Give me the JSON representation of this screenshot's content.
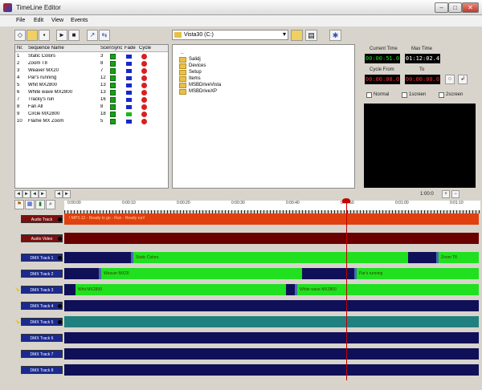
{
  "window": {
    "title": "TimeLine Editor"
  },
  "menu": [
    "File",
    "Edit",
    "View",
    "Events"
  ],
  "sequence_table": {
    "headers": [
      "Nr.",
      "Sequence Name",
      "Scene",
      "Sync",
      "Fade",
      "Cycle"
    ],
    "rows": [
      {
        "nr": "1",
        "name": "Static Colors",
        "scene": "3",
        "fade": "blue"
      },
      {
        "nr": "2",
        "name": "Zoom T8",
        "scene": "8",
        "fade": "blue"
      },
      {
        "nr": "3",
        "name": "Weaver MX20",
        "scene": "7",
        "fade": "blue"
      },
      {
        "nr": "4",
        "name": "Par's running",
        "scene": "12",
        "fade": "blue"
      },
      {
        "nr": "5",
        "name": "Whit MX2800",
        "scene": "13",
        "fade": "blue"
      },
      {
        "nr": "6",
        "name": "White wave MX2800",
        "scene": "13",
        "fade": "blue"
      },
      {
        "nr": "7",
        "name": "Tracky's run",
        "scene": "16",
        "fade": "blue"
      },
      {
        "nr": "8",
        "name": "Fan All",
        "scene": "8",
        "fade": "blue"
      },
      {
        "nr": "9",
        "name": "Circle MX2800",
        "scene": "18",
        "fade": "green"
      },
      {
        "nr": "10",
        "name": "Flame MX Zoom",
        "scene": "5",
        "fade": "blue"
      }
    ]
  },
  "folder": {
    "path": "Vista30 (C:)",
    "items": [
      "..",
      "Salidj",
      "Devices",
      "Setup",
      "Items",
      "MSBDriveVista",
      "MSBDriveXP"
    ]
  },
  "time_panel": {
    "current_time_label": "Current Time",
    "max_time_label": "Max Time",
    "current_time": "00:00:51.0",
    "max_time": "01:12:02.4",
    "cycle_from_label": "Cycle From",
    "to_label": "To",
    "cycle_from": "00:00:00.0",
    "cycle_to": "00:00:00.0",
    "normal_label": "Normal",
    "screen1_label": "1screen",
    "screen2_label": "2screen"
  },
  "timeline": {
    "ruler_labels": [
      "0:00:00",
      "0:00:10",
      "0:00:20",
      "0:00:30",
      "0:00:40",
      "0:00:50",
      "0:01:00",
      "0:01:10"
    ],
    "zoom_label": "1:00:0",
    "tracks": [
      {
        "label": "Audio Track",
        "kind": "audio",
        "text": "\\ MP3-12 - Ready to go - Run - Ready run!"
      },
      {
        "label": "Audio Video",
        "kind": "video"
      },
      {
        "label": "DMX Track 1",
        "kind": "dmx"
      },
      {
        "label": "DMX Track 2",
        "kind": "dmx"
      },
      {
        "label": "DMX Track 3",
        "kind": "dmx"
      },
      {
        "label": "DMX Track 4",
        "kind": "dmx"
      },
      {
        "label": "DMX Track 5",
        "kind": "dmx"
      },
      {
        "label": "DMX Track 6",
        "kind": "dmx"
      },
      {
        "label": "DMX Track 7",
        "kind": "dmx"
      },
      {
        "label": "DMX Track 8",
        "kind": "dmx"
      }
    ],
    "clips": {
      "static_colors": "Static Colors",
      "zoom_t8": "Zoom T8",
      "weaver_mx20": "Weaver MX20",
      "pars_running": "Par's running",
      "whit_mx2800": "Whit MX2800",
      "white_wave": "White wave MX2800"
    }
  },
  "colors": {
    "audio_track": "#e04010",
    "video_track": "#6a0000",
    "dmx_track": "#101058",
    "teal_track": "#208080",
    "clip_green": "#20e020",
    "track_label_bg": "#7a1010"
  }
}
